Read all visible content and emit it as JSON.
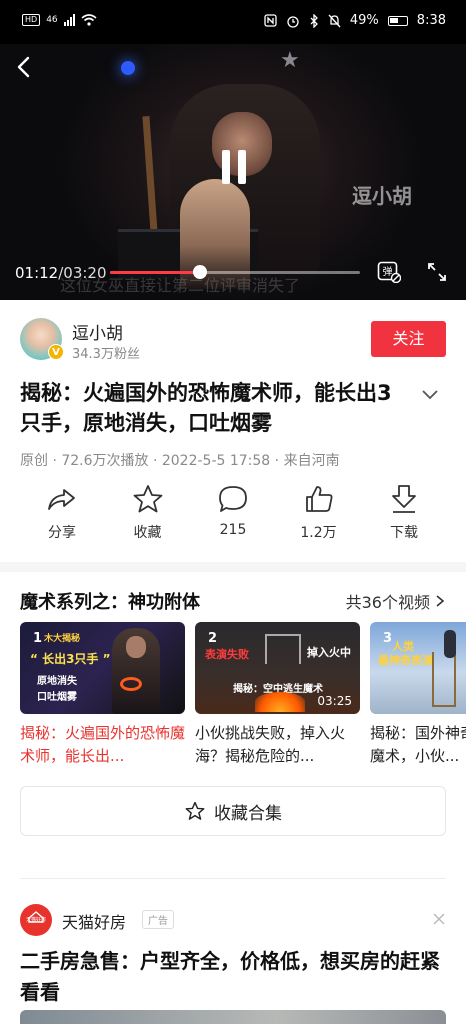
{
  "status_bar": {
    "left": [
      "HD",
      "46"
    ],
    "battery": "49%",
    "time": "8:38"
  },
  "player": {
    "current_time": "01:12",
    "duration": "/03:20",
    "progress": 0.36,
    "subtitle": "这位女巫直接让第二位评审消失了",
    "watermark": "逗小胡",
    "danmu_label": "弹"
  },
  "author": {
    "name": "逗小胡",
    "fans": "34.3万粉丝",
    "badge": "V",
    "follow_label": "关注"
  },
  "video": {
    "title": "揭秘：火遍国外的恐怖魔术师，能长出3只手，原地消失，口吐烟雾",
    "meta": "原创 · 72.6万次播放 · 2022-5-5 17:58 · 来自河南"
  },
  "actions": [
    {
      "label": "分享",
      "icon": "share-icon"
    },
    {
      "label": "收藏",
      "icon": "star-icon"
    },
    {
      "label": "215",
      "icon": "comment-icon"
    },
    {
      "label": "1.2万",
      "icon": "like-icon"
    },
    {
      "label": "下载",
      "icon": "download-icon"
    }
  ],
  "series": {
    "title": "魔术系列之：神功附体",
    "count": "共36个视频",
    "cards": [
      {
        "num": "1",
        "tag": "木大揭秘",
        "caption1": "“ 长出3只手 ”",
        "caption2": "原地消失",
        "caption3": "口吐烟雾",
        "title": "揭秘：火遍国外的恐怖魔术师，能长出...",
        "active": true
      },
      {
        "num": "2",
        "tag": "表演失败",
        "caption1": "掉入火中",
        "caption2": "揭秘：空中逃生魔术",
        "duration": "03:25",
        "title": "小伙挑战失败，掉入火海？揭秘危险的...",
        "active": false
      },
      {
        "num": "3",
        "tag": "人类",
        "caption1": "最神奇表演",
        "title": "揭秘：国外神奇悬空隐形魔术，小伙...",
        "active": false
      }
    ],
    "collect_label": "收藏合集"
  },
  "ad": {
    "brand": "天猫好房",
    "logo_text": "天猫好房",
    "tag": "广告",
    "title": "二手房急售：户型齐全，价格低，想买房的赶紧看看"
  },
  "colors": {
    "accent": "#f0333f",
    "active_title": "#e8332f",
    "progress": "#ff3b4a"
  }
}
